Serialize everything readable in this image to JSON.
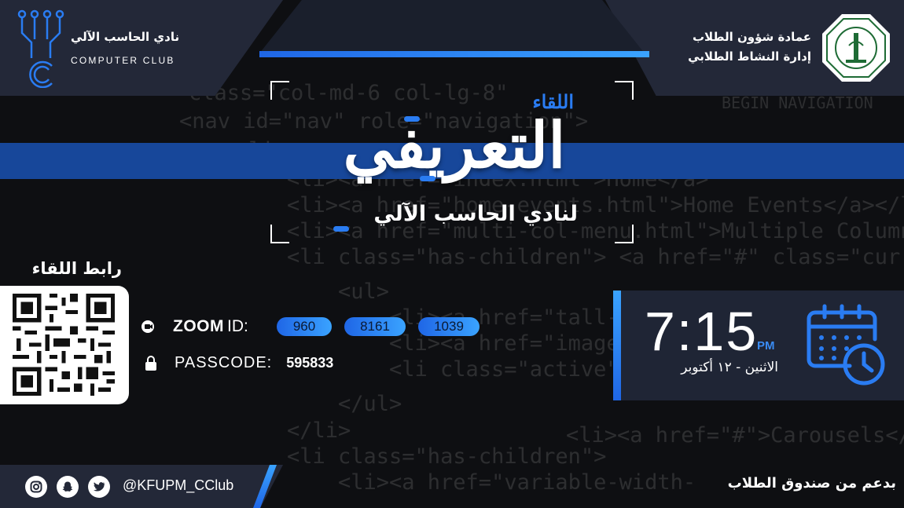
{
  "background_code": [
    "class=\"col-md-6 col-lg-8\"",
    "<nav id=\"nav\" role=\"navigation\">",
    "<li>",
    "<li><a href=\"index.html\">Home</a>",
    "<li><a href=\"home-events.html\">Home Events</a></li>",
    "<li><a href=\"multi-col-menu.html\">Multiple Column Menu</a>",
    "<li class=\"has-children\"> <a href=\"#\" class=\"current\">",
    "<ul>",
    "<li><a href=\"tall-",
    "<li><a href=\"image-",
    "<li class=\"active\">",
    "</ul>",
    "</li>",
    "<li><a href=\"#\">Carousels</a>",
    "<li class=\"has-children\">",
    "<li><a href=\"variable-width-",
    "BEGIN NAVIGATION"
  ],
  "club": {
    "name_ar": "نادي الحاسب الآلي",
    "name_en": "COMPUTER CLUB"
  },
  "deanship": {
    "line1": "عمادة شؤون الطلاب",
    "line2": "إدارة النشاط الطلابي"
  },
  "title": {
    "small": "اللقاء",
    "big": "التعريفي",
    "sub": "لنادي الحاسب الآلي"
  },
  "meeting_link_label": "رابط اللقاء",
  "zoom": {
    "word": "ZOOM",
    "id_label": "ID:",
    "id_parts": [
      "960",
      "8161",
      "1039"
    ],
    "passcode_label": "PASSCODE:",
    "passcode": "595833"
  },
  "event": {
    "time": "7:15",
    "ampm": "PM",
    "date": "الاثنين - ١٢ أكتوبر"
  },
  "footer": {
    "handle": "@KFUPM_CClub",
    "support": "بدعم من صندوق الطلاب",
    "social_icons": [
      "instagram-icon",
      "snapchat-icon",
      "twitter-icon"
    ]
  },
  "colors": {
    "accent": "#2a7cf2",
    "band": "#17479a",
    "panel": "#232838",
    "background": "#0e0f12"
  }
}
